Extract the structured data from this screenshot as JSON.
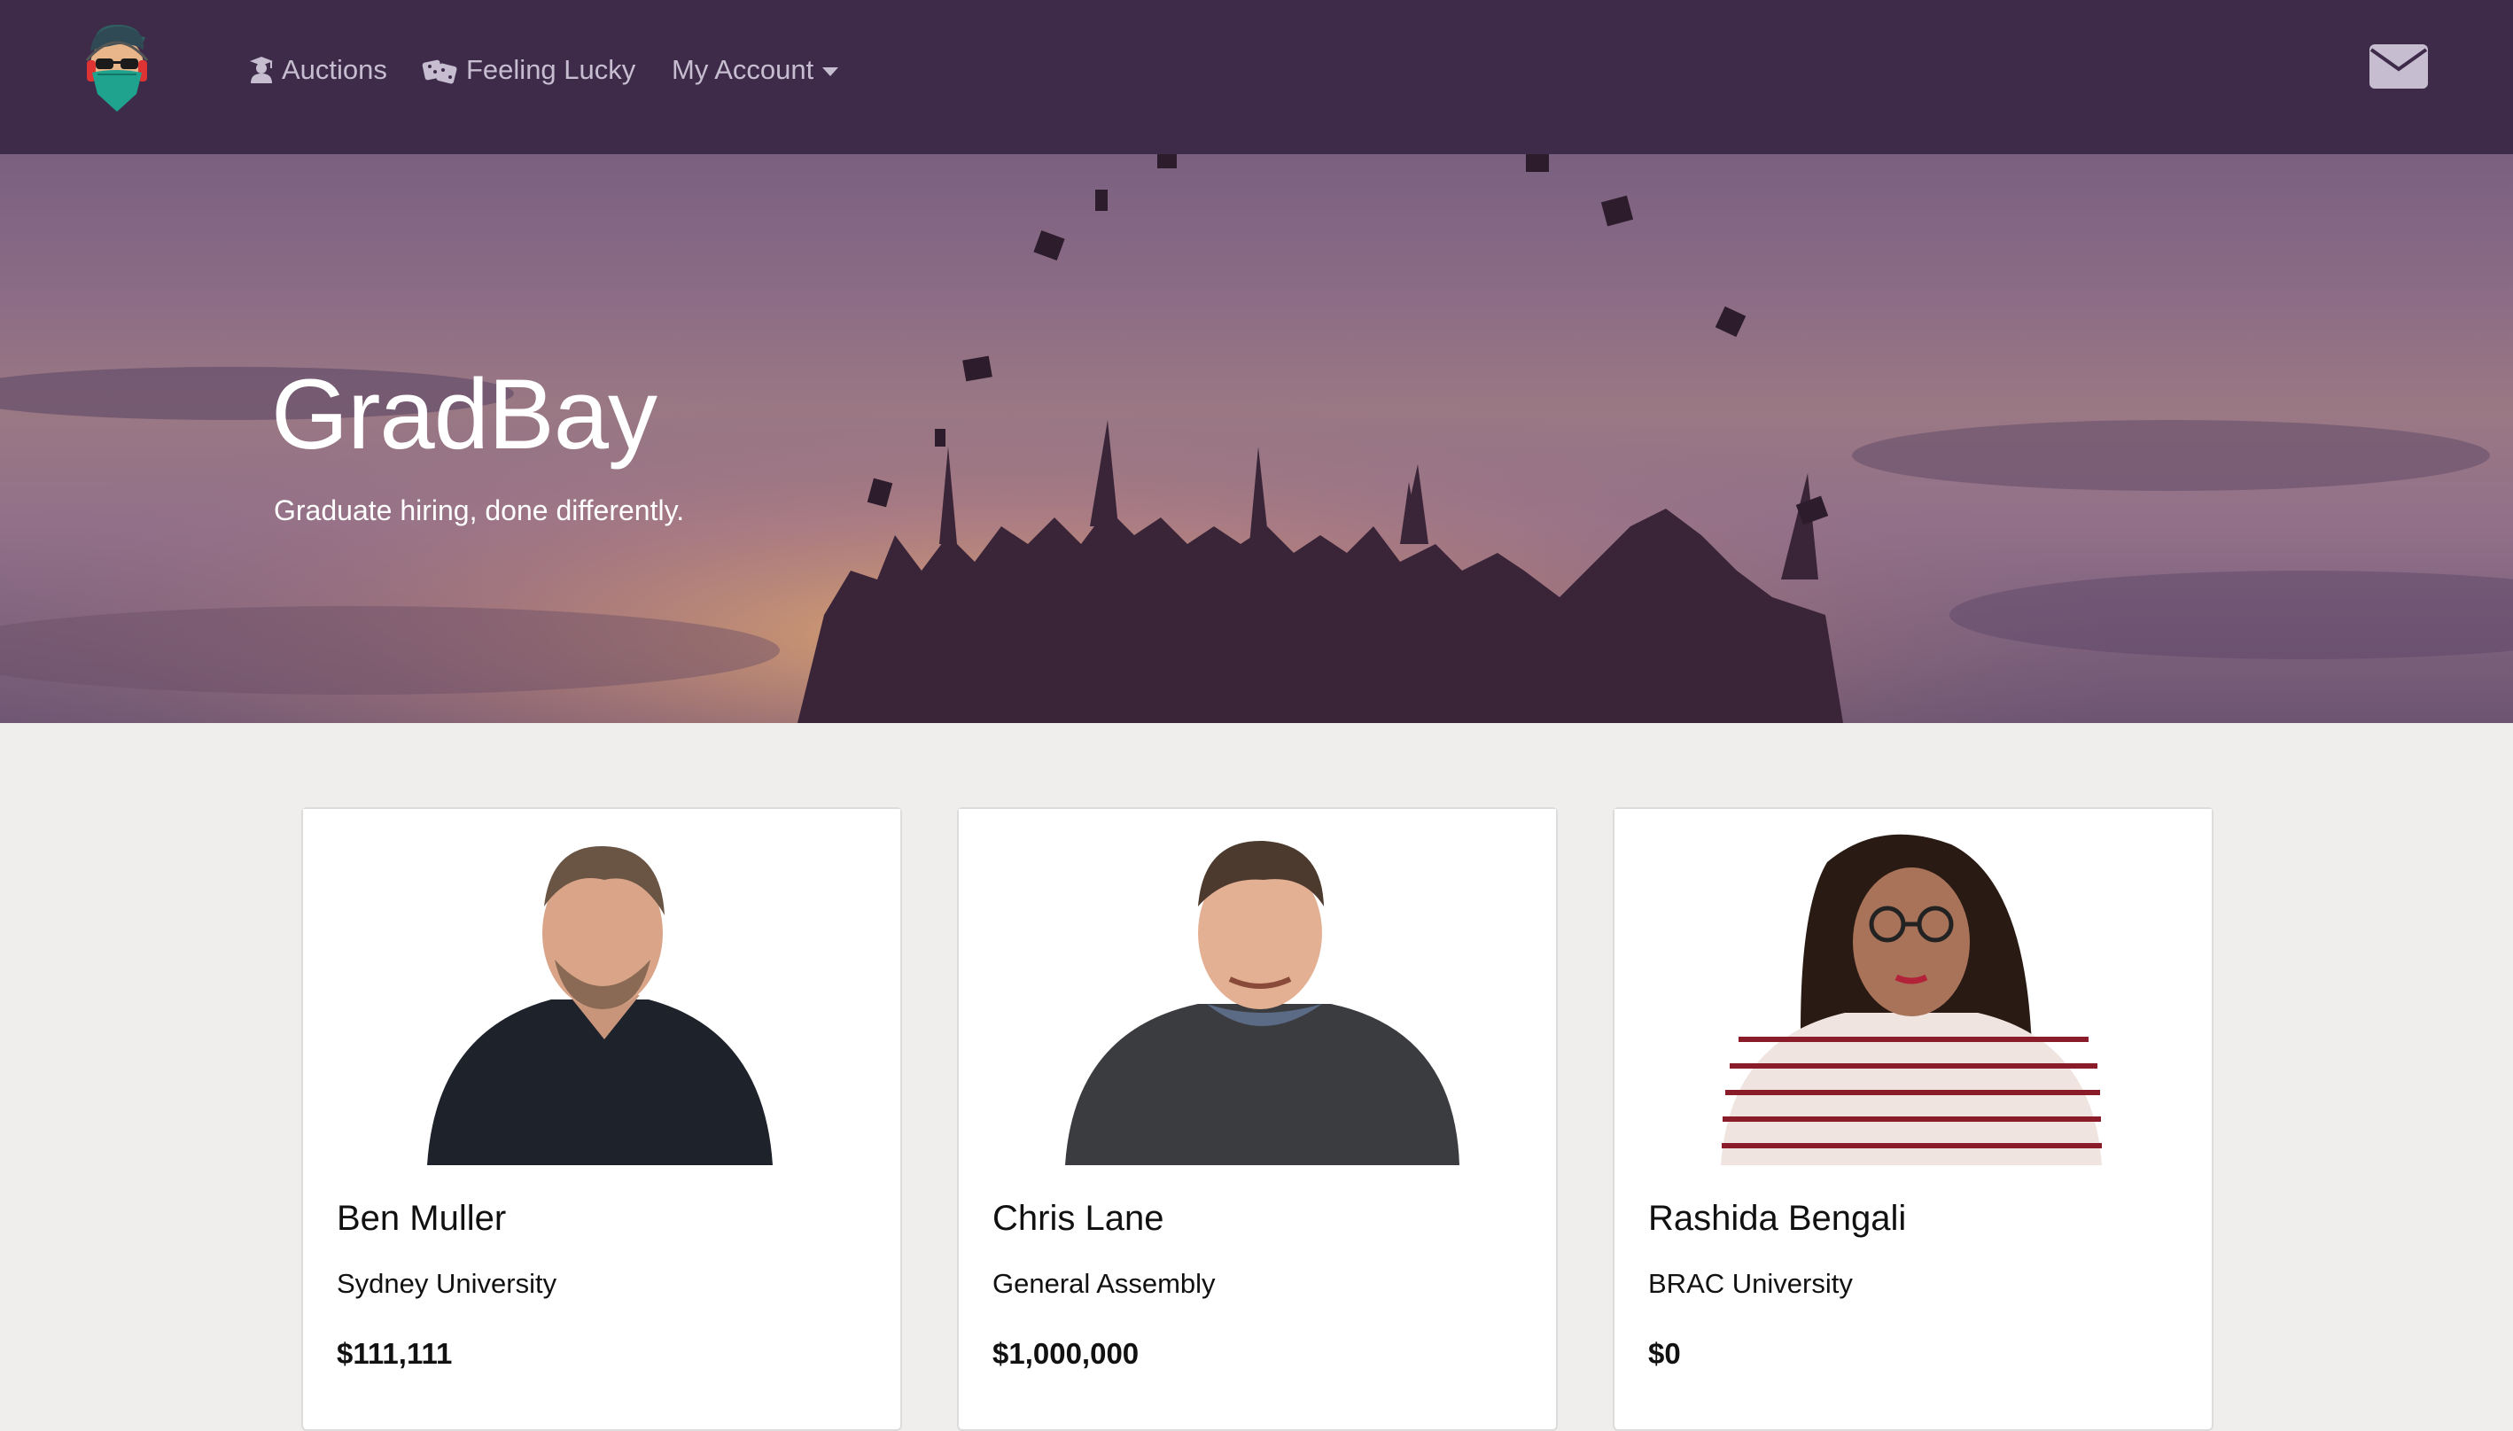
{
  "nav": {
    "auctions_label": "Auctions",
    "lucky_label": "Feeling Lucky",
    "account_label": "My Account"
  },
  "hero": {
    "title": "GradBay",
    "subtitle": "Graduate hiring, done differently."
  },
  "cards": [
    {
      "name": "Ben Muller",
      "school": "Sydney University",
      "price": "$111,111"
    },
    {
      "name": "Chris Lane",
      "school": "General Assembly",
      "price": "$1,000,000"
    },
    {
      "name": "Rashida Bengali",
      "school": "BRAC University",
      "price": "$0"
    }
  ],
  "colors": {
    "navbar": "#3e2b4a",
    "nav_text": "#c7bdd0",
    "page_bg": "#efeeec",
    "card_bg": "#ffffff"
  },
  "icons": {
    "logo": "masked-hacker-logo",
    "auctions": "graduate-icon",
    "lucky": "dice-icon",
    "mail": "envelope-icon"
  }
}
